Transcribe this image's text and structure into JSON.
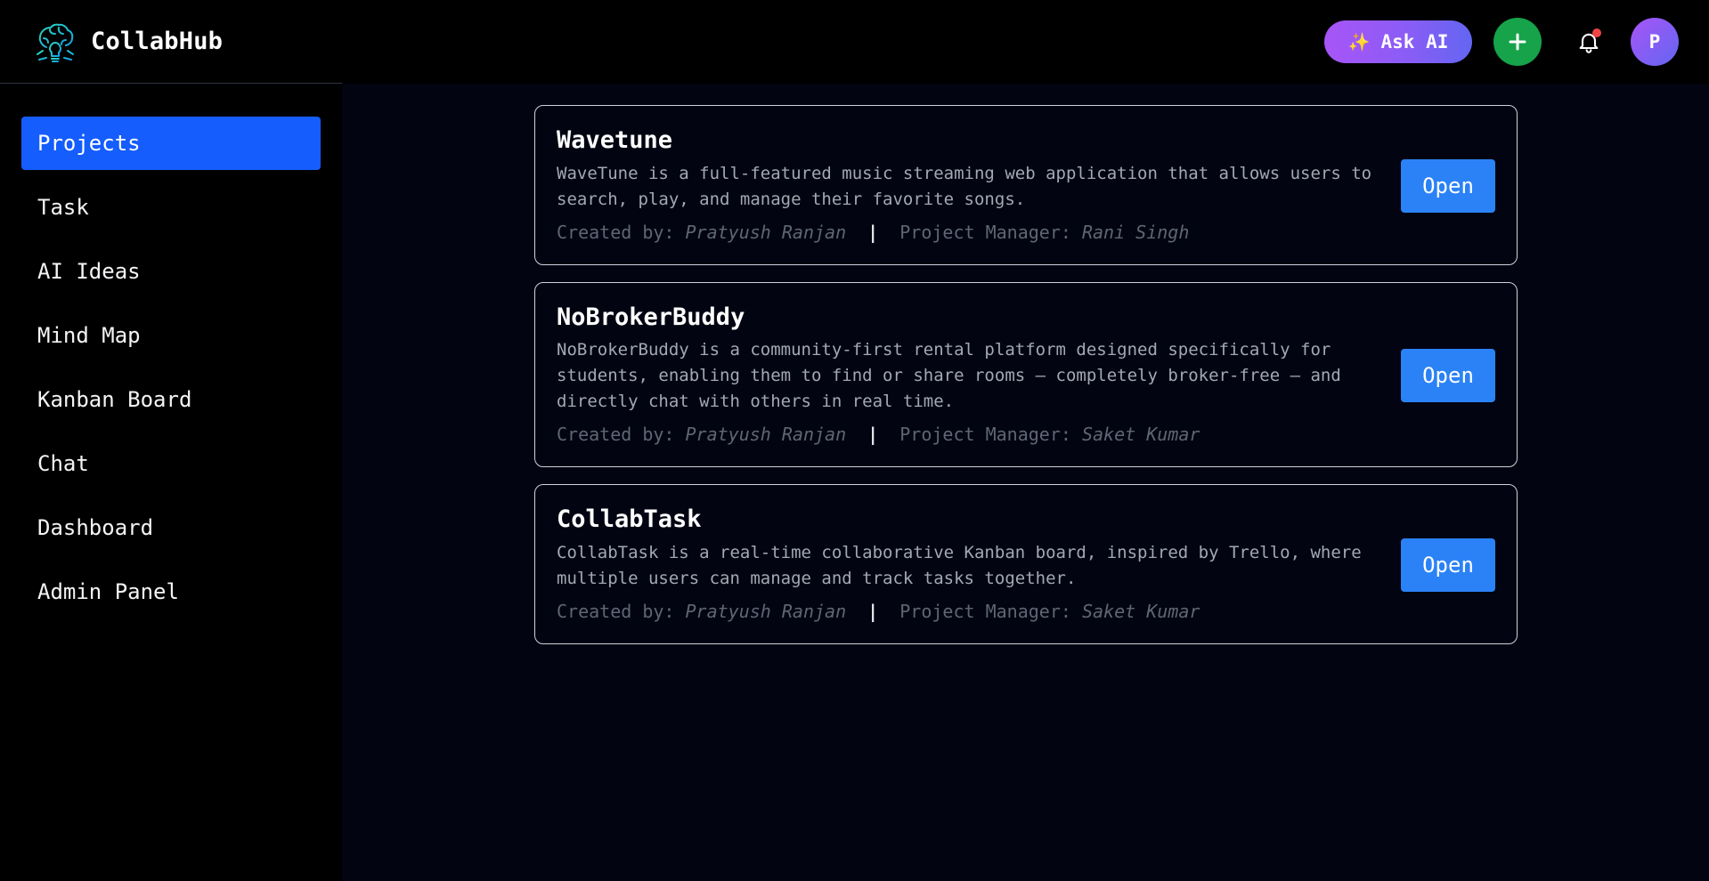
{
  "app": {
    "name": "CollabHub",
    "logo_icon": "brain-lightbulb-icon"
  },
  "header": {
    "ask_ai_icon": "sparkles-icon",
    "ask_ai_label": "Ask AI",
    "add_icon": "plus-icon",
    "notifications_icon": "bell-icon",
    "avatar_initial": "P",
    "colors": {
      "ask_ai_gradient": [
        "#a855f7",
        "#6366f1"
      ],
      "add_button": "#16a34a",
      "notification_dot": "#ef4444"
    }
  },
  "sidebar": {
    "items": [
      {
        "label": "Projects",
        "active": true
      },
      {
        "label": "Task",
        "active": false
      },
      {
        "label": "AI Ideas",
        "active": false
      },
      {
        "label": "Mind Map",
        "active": false
      },
      {
        "label": "Kanban Board",
        "active": false
      },
      {
        "label": "Chat",
        "active": false
      },
      {
        "label": "Dashboard",
        "active": false
      },
      {
        "label": "Admin Panel",
        "active": false
      }
    ],
    "active_color": "#155dfc"
  },
  "projects": [
    {
      "title": "Wavetune",
      "description": "WaveTune is a full-featured music streaming web application that allows users to search, play, and manage their favorite songs.",
      "created_by_label": "Created by:",
      "created_by": "Pratyush Ranjan",
      "separator": "|",
      "manager_label": "Project Manager:",
      "manager": "Rani Singh",
      "open_label": "Open"
    },
    {
      "title": "NoBrokerBuddy",
      "description": "NoBrokerBuddy is a community-first rental platform designed specifically for students, enabling them to find or share rooms – completely broker-free – and directly chat with others in real time.",
      "created_by_label": "Created by:",
      "created_by": "Pratyush Ranjan",
      "separator": "|",
      "manager_label": "Project Manager:",
      "manager": "Saket Kumar",
      "open_label": "Open"
    },
    {
      "title": "CollabTask",
      "description": "CollabTask is a real-time collaborative Kanban board, inspired by Trello, where multiple users can manage and track tasks together.",
      "created_by_label": "Created by:",
      "created_by": "Pratyush Ranjan",
      "separator": "|",
      "manager_label": "Project Manager:",
      "manager": "Saket Kumar",
      "open_label": "Open"
    }
  ],
  "open_button_color": "#2b82f6"
}
